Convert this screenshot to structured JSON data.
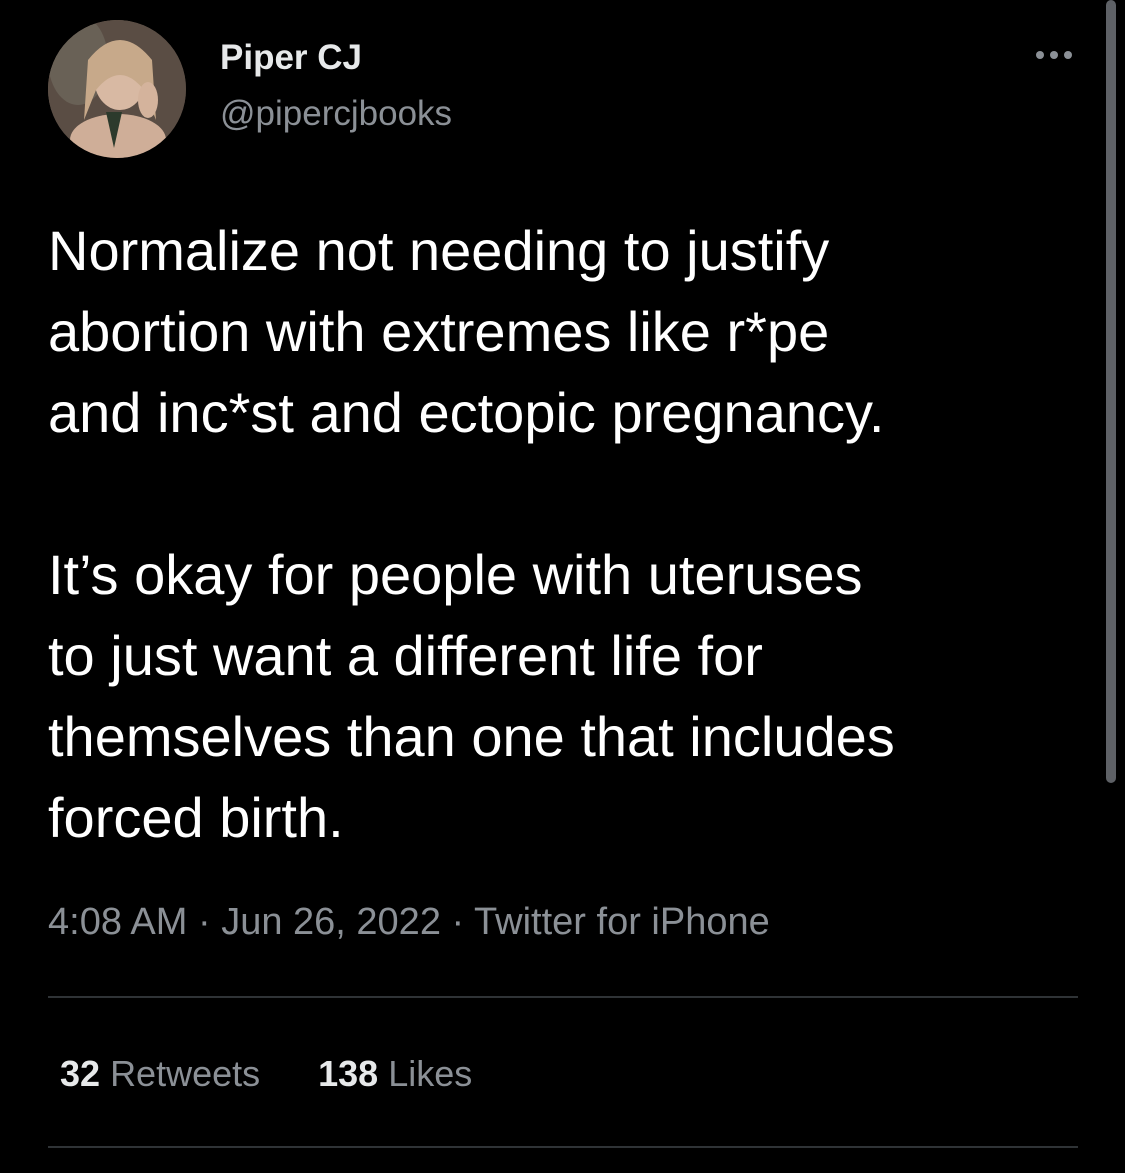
{
  "author": {
    "display_name": "Piper CJ",
    "handle": "@pipercjbooks"
  },
  "tweet": {
    "text": "Normalize not needing to justify\nabortion with extremes like r*pe\nand inc*st and ectopic pregnancy.\n\nIt’s okay for people with uteruses\nto just want a different life for\nthemselves than one that includes\nforced birth.",
    "time": "4:08 AM",
    "date": "Jun 26, 2022",
    "source": "Twitter for iPhone",
    "separator": " · "
  },
  "stats": {
    "retweets_count": "32",
    "retweets_label": "Retweets",
    "likes_count": "138",
    "likes_label": "Likes"
  },
  "icons": {
    "more": "more-horizontal-icon"
  },
  "colors": {
    "background": "#000000",
    "primary_text": "#ffffff",
    "secondary_text": "#8b9096",
    "divider": "#2f3336"
  }
}
